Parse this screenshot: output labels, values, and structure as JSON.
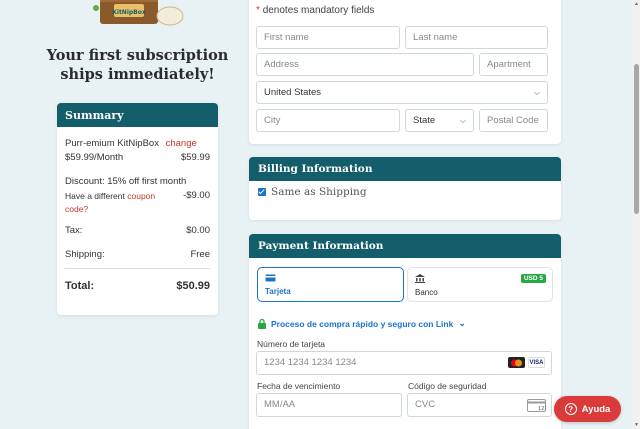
{
  "hero": {
    "tagline": "Your first subscription ships immediately!",
    "box_label": "KitNipBox"
  },
  "summary": {
    "title": "Summary",
    "product_name": "Purr-emium KitNipBox",
    "change_label": "change",
    "plan_price": "$59.99/Month",
    "plan_amount": "$59.99",
    "discount_label": "Discount: 15% off first month",
    "coupon_prefix": "Have a different",
    "coupon_link": "coupon",
    "coupon_suffix": "code?",
    "discount_amount": "-$9.00",
    "tax_label": "Tax:",
    "tax_value": "$0.00",
    "shipping_label": "Shipping:",
    "shipping_value": "Free",
    "total_label": "Total:",
    "total_value": "$50.99"
  },
  "shipping_form": {
    "mandatory_note": "denotes mandatory fields",
    "mandatory_star": "*",
    "first_name_placeholder": "First name",
    "last_name_placeholder": "Last name",
    "address_placeholder": "Address",
    "apartment_placeholder": "Apartment",
    "country_value": "United States",
    "city_placeholder": "City",
    "state_value": "State",
    "postal_placeholder": "Postal Code"
  },
  "billing": {
    "title": "Billing Information",
    "same_as_shipping_label": "Same as Shipping",
    "same_as_shipping_checked": true
  },
  "payment": {
    "title": "Payment Information",
    "tab_card": "Tarjeta",
    "tab_bank": "Banco",
    "bank_badge": "USD 5",
    "link_text": "Proceso de compra rápido y seguro con Link",
    "card_number_label": "Número de tarjeta",
    "card_number_placeholder": "1234 1234 1234 1234",
    "brand_visa": "VISA",
    "expiry_label": "Fecha de vencimiento",
    "expiry_placeholder": "MM/AA",
    "cvc_label": "Código de seguridad",
    "cvc_placeholder": "CVC",
    "cvc_icon_text": "123"
  },
  "help": {
    "label": "Ayuda"
  },
  "colors": {
    "teal": "#145d6b",
    "accent_red": "#c0392b",
    "link_blue": "#1a73c9",
    "help_red": "#d93a3a"
  }
}
